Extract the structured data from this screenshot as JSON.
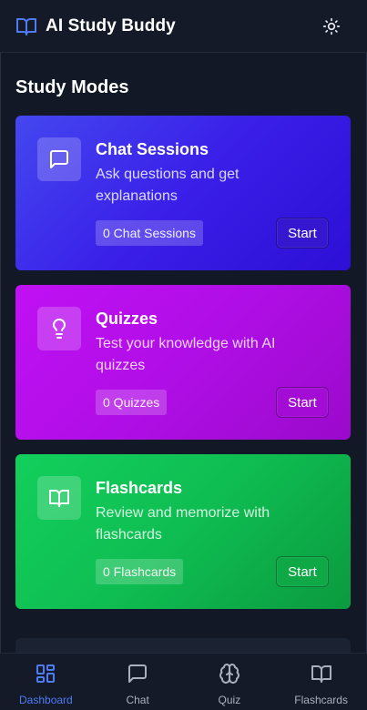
{
  "header": {
    "title": "AI Study Buddy",
    "logo_icon": "book-open-icon",
    "theme_toggle_icon": "sun-icon"
  },
  "main": {
    "section_title": "Study Modes",
    "cards": [
      {
        "title": "Chat Sessions",
        "description": "Ask questions and get explanations",
        "badge": "0 Chat Sessions",
        "button": "Start",
        "icon": "message-square-icon",
        "color": "#3a1fe8"
      },
      {
        "title": "Quizzes",
        "description": "Test your knowledge with AI quizzes",
        "badge": "0 Quizzes",
        "button": "Start",
        "icon": "lightbulb-icon",
        "color": "#b00ee6"
      },
      {
        "title": "Flashcards",
        "description": "Review and memorize with flashcards",
        "badge": "0 Flashcards",
        "button": "Start",
        "icon": "book-open-icon",
        "color": "#0fbd52"
      }
    ]
  },
  "bottom_nav": {
    "active": "Dashboard",
    "active_color": "#4f7bf7",
    "items": [
      {
        "label": "Dashboard",
        "icon": "layout-dashboard-icon"
      },
      {
        "label": "Chat",
        "icon": "message-square-icon"
      },
      {
        "label": "Quiz",
        "icon": "brain-icon"
      },
      {
        "label": "Flashcards",
        "icon": "book-open-icon"
      }
    ]
  }
}
